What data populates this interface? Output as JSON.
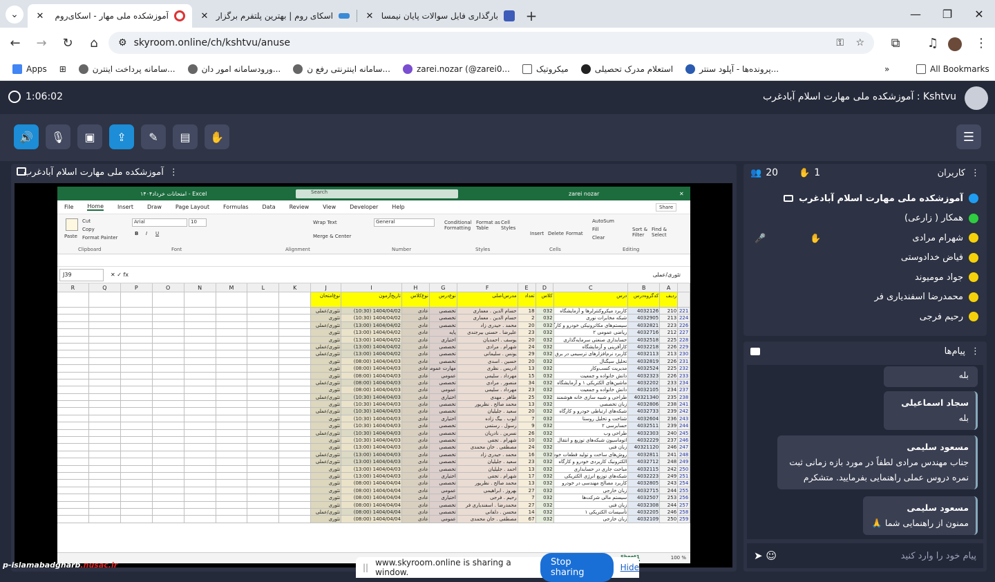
{
  "browser": {
    "tabs": [
      {
        "title": "آموزشکده ملی مهار - اسکای‌روم",
        "active": true
      },
      {
        "title": "اسکای روم | بهترین پلتفرم برگزاری",
        "active": false
      },
      {
        "title": "بارگذاری فایل سوالات پایان نیمسال",
        "active": false
      }
    ],
    "url": "skyroom.online/ch/kshtvu/anuse",
    "bookmarks": [
      "Apps",
      "سامانه پرداخت اینترن...",
      "ورودسامانه امور دان...",
      "سامانه اینترنتی رفع ن...",
      "zarei.nozar (@zarei0...",
      "میکروتیک",
      "استعلام مدرک تحصیلی",
      "پرونده‌ها - آپلود سنتر..."
    ],
    "all_bookmarks": "All Bookmarks"
  },
  "app": {
    "timer": "1:06:02",
    "room_title": "Kshtvu : آموزشکده ملی مهارت اسلام آبادغرب",
    "share_title": "آموزشکده ملی مهارت اسلام آبادغرب",
    "users_title": "کاربران",
    "users_count": "20",
    "hands_count": "1",
    "users": [
      "آموزشکده ملی مهارت اسلام آبادغرب",
      "همکار ( زارعی)",
      "شهرام مرادی",
      "فیاض خدادوستی",
      "جواد مومیوند",
      "محمدرضا اسفندیاری فر",
      "رحیم فرجی"
    ],
    "messages_title": "پیام‌ها",
    "messages": [
      {
        "sender": "",
        "text": "بله"
      },
      {
        "sender": "سجاد اسماعیلی",
        "text": "بله"
      },
      {
        "sender": "مسعود سلیمی",
        "text": "جناب مهندس مرادی لطفاً در مورد بازه زمانی ثبت نمره دروس عملی راهنمایی بفرمایید. متشکرم"
      },
      {
        "sender": "مسعود سلیمی",
        "text": "ممنون از راهنمایی شما 🙏"
      }
    ],
    "chat_placeholder": "پیام خود را وارد کنید"
  },
  "sharing": {
    "text": "www.skyroom.online is sharing a window.",
    "stop": "Stop sharing",
    "hide": "Hide"
  },
  "watermark": {
    "left": "p-islamabadgharb",
    "right": ".nusac.ir"
  },
  "excel": {
    "title": "امتحانات خرداد۱۴۰۴ - Excel",
    "search": "Search",
    "user": "zarei nozar",
    "menus": [
      "File",
      "Home",
      "Insert",
      "Draw",
      "Page Layout",
      "Formulas",
      "Data",
      "Review",
      "View",
      "Developer",
      "Help"
    ],
    "share": "Share",
    "ribbon": {
      "paste": "Paste",
      "cut": "Cut",
      "copy": "Copy",
      "format_painter": "Format Painter",
      "clipboard": "Clipboard",
      "font_name": "Arial",
      "font_size": "10",
      "font": "Font",
      "wrap": "Wrap Text",
      "merge": "Merge & Center",
      "alignment": "Alignment",
      "general": "General",
      "number": "Number",
      "cond": "Conditional Formatting",
      "fmt_table": "Format as Table",
      "cell_styles": "Cell Styles",
      "styles": "Styles",
      "insert": "Insert",
      "delete": "Delete",
      "format": "Format",
      "cells": "Cells",
      "autosum": "AutoSum",
      "fill": "Fill",
      "clear": "Clear",
      "sort": "Sort & Filter",
      "find": "Find & Select",
      "editing": "Editing"
    },
    "namebox": "J39",
    "fx_value": "تئوری/عملی",
    "cols": [
      "R",
      "Q",
      "P",
      "O",
      "N",
      "M",
      "L",
      "K",
      "J",
      "I",
      "H",
      "G",
      "F",
      "E",
      "D",
      "C",
      "B",
      "A"
    ],
    "headers": [
      "نوع‌امتحان",
      "تاریخ‌آزمون",
      "نوع‌کلاس",
      "نوع‌درس",
      "مدرس‌اصلی",
      "تعداد",
      "کلاس",
      "درس",
      "کدگروه‌درس",
      "ردیف"
    ],
    "rows": [
      [
        "221",
        "210",
        "4032126",
        "کاربرد میکروکنترلرها و آزمایشگاه",
        "032",
        "18",
        "حسام الدین . معماری",
        "تخصصی",
        "عادی",
        "1404/04/02 (10:30)",
        "تئوری/عملی"
      ],
      [
        "224",
        "213",
        "4032905",
        "شبکه مخابرات نوری",
        "032",
        "2",
        "حسام الدین . معماری",
        "تخصصی",
        "عادی",
        "1404/04/02 (10:30)",
        "تئوری"
      ],
      [
        "226",
        "223",
        "4032821",
        "سیستم‌های مکاترونیکی خودرو و کارگاه",
        "032",
        "20",
        "محمد . حیدری زاد",
        "تخصصی",
        "عادی",
        "1404/04/02 (13:00)",
        "تئوری/عملی"
      ],
      [
        "227",
        "212",
        "4032716",
        "ریاضی عمومی ۲",
        "032",
        "23",
        "علیرضا . حسنی بیرجندی",
        "پایه",
        "عادی",
        "1404/04/02 (13:00)",
        "تئوری"
      ],
      [
        "228",
        "225",
        "4032518",
        "حسابداری صنعتی سرمایه‌گذاری",
        "032",
        "20",
        "یوسف . احمدیان",
        "اختیاری",
        "عادی",
        "1404/04/02 (13:00)",
        "تئوری"
      ],
      [
        "229",
        "226",
        "4032218",
        "کارآفرینی و آزمایشگاه",
        "032",
        "24",
        "شهرام . مرادی",
        "تخصصی",
        "عادی",
        "1404/04/02 (13:00)",
        "تئوری/عملی"
      ],
      [
        "230",
        "213",
        "4032113",
        "کاربرد نرم‌افزارهای ترسیمی در برق",
        "032",
        "29",
        "یونس . سلیمانی",
        "تخصصی",
        "عادی",
        "1404/04/02 (13:00)",
        "تئوری/عملی"
      ],
      [
        "231",
        "226",
        "4032819",
        "تحلیل سیگنال",
        "032",
        "20",
        "حسین . اسدی",
        "تخصصی",
        "عادی",
        "1404/04/03 (08:00)",
        "تئوری"
      ],
      [
        "232",
        "225",
        "4032524",
        "مدیریت کسب‌وکار",
        "032",
        "13",
        "ادریس . نظری",
        "مهارت عمومی",
        "عادی",
        "1404/04/03 (08:00)",
        "تئوری"
      ],
      [
        "233",
        "226",
        "4032323",
        "دانش خانواده و جمعیت",
        "032",
        "15",
        "مهرداد . سلیمی",
        "عمومی",
        "عادی",
        "1404/04/03 (08:00)",
        "تئوری"
      ],
      [
        "234",
        "233",
        "4032202",
        "ماشین‌های الکتریکی ۱ و آزمایشگاه",
        "032",
        "34",
        "منصور . مرادی",
        "تخصصی",
        "عادی",
        "1404/04/03 (08:00)",
        "تئوری/عملی"
      ],
      [
        "237",
        "234",
        "4032105",
        "دانش خانواده و جمعیت",
        "032",
        "23",
        "مهرداد . سلیمی",
        "عمومی",
        "عادی",
        "1404/04/03 (08:00)",
        "تئوری"
      ],
      [
        "238",
        "235",
        "40321340",
        "طراحی و شبیه سازی خانه هوشمند",
        "032",
        "25",
        "طاهر . مهدی",
        "اختیاری",
        "عادی",
        "1404/04/03 (10:30)",
        "تئوری/عملی"
      ],
      [
        "241",
        "238",
        "4032806",
        "زبان تخصصی",
        "032",
        "13",
        "محمد صالح . نظریور",
        "تخصصی",
        "عادی",
        "1404/04/03 (10:30)",
        "تئوری"
      ],
      [
        "242",
        "239",
        "4032733",
        "شبکه‌های ارتباطی خودرو و کارگاه",
        "032",
        "20",
        "سعید . جلیلیان",
        "تخصصی",
        "عادی",
        "1404/04/03 (10:30)",
        "تئوری/عملی"
      ],
      [
        "243",
        "236",
        "4032604",
        "شناخت و تحلیل روستا",
        "032",
        "7",
        "ایوب . بیگ زاده",
        "اختیاری",
        "عادی",
        "1404/04/03 (10:30)",
        "تئوری"
      ],
      [
        "244",
        "239",
        "4032511",
        "حسابرسی ۲",
        "032",
        "9",
        "رسول . رستمی",
        "تخصصی",
        "عادی",
        "1404/04/03 (10:30)",
        "تئوری"
      ],
      [
        "245",
        "240",
        "4032303",
        "طراحی وب",
        "032",
        "26",
        "نسرین . نادریان",
        "تخصصی",
        "عادی",
        "1404/04/03 (10:30)",
        "تئوری/عملی"
      ],
      [
        "246",
        "237",
        "4032229",
        "اتوماسیون شبکه‌های توزیع و انتقال",
        "032",
        "10",
        "شهرام . تجفی",
        "تخصصی",
        "عادی",
        "1404/04/03 (10:30)",
        "تئوری"
      ],
      [
        "247",
        "246",
        "40321120",
        "زبان فنی",
        "032",
        "24",
        "مصطفی . خان محمدی",
        "تخصصی",
        "عادی",
        "1404/04/03 (13:00)",
        "تئوری"
      ],
      [
        "248",
        "241",
        "4032811",
        "روش‌های ساخت و تولید قطعات خودرو",
        "032",
        "16",
        "محمد . حیدری زاد",
        "تخصصی",
        "عادی",
        "1404/04/03 (13:00)",
        "تئوری/عملی"
      ],
      [
        "249",
        "248",
        "4032712",
        "الکترونیک کاربردی خودرو و کارگاه",
        "032",
        "23",
        "سعید . جلیلیان",
        "تخصصی",
        "عادی",
        "1404/04/03 (13:00)",
        "تئوری/عملی"
      ],
      [
        "250",
        "242",
        "4032115",
        "مباحث جاری در حسابداری",
        "032",
        "13",
        "احمد . جلیلیان",
        "تخصصی",
        "عادی",
        "1404/04/03 (13:00)",
        "تئوری"
      ],
      [
        "251",
        "249",
        "4032223",
        "شبکه‌های توزیع انرژی الکتریکی",
        "032",
        "17",
        "شهرام . تجفی",
        "اختیاری",
        "عادی",
        "1404/04/03 (13:00)",
        "تئوری"
      ],
      [
        "254",
        "243",
        "4032805",
        "کاربرد مصالح مهندسی در خودرو",
        "032",
        "13",
        "محمد صالح . نظریور",
        "تخصصی",
        "عادی",
        "1404/04/04 (08:00)",
        "تئوری"
      ],
      [
        "255",
        "244",
        "4032715",
        "زبان خارجی",
        "032",
        "27",
        "بهروز . ابراهیمی",
        "عمومی",
        "عادی",
        "1404/04/04 (08:00)",
        "تئوری"
      ],
      [
        "256",
        "253",
        "4032507",
        "سیستم مالی شرکت‌ها",
        "032",
        "7",
        "رحیم . فرجی",
        "اختیاری",
        "عادی",
        "1404/04/04 (08:00)",
        "تئوری"
      ],
      [
        "257",
        "244",
        "4032308",
        "زبان فنی",
        "032",
        "27",
        "محمدرضا . اسفندیاری فر",
        "تخصصی",
        "عادی",
        "1404/04/04 (08:00)",
        "تئوری"
      ],
      [
        "258",
        "246",
        "4032205",
        "تأسیسات الکتریکی ۱",
        "032",
        "14",
        "محسن . دلفانی",
        "تخصصی",
        "عادی",
        "1404/04/04 (08:00)",
        "تئوری/عملی"
      ],
      [
        "259",
        "250",
        "4032109",
        "زبان خارجی",
        "032",
        "67",
        "مصطفی . خان محمدی",
        "عمومی",
        "عادی",
        "1404/04/04 (08:00)",
        "تئوری"
      ]
    ],
    "sheet": "Sheet1",
    "zoom": "100 %"
  }
}
